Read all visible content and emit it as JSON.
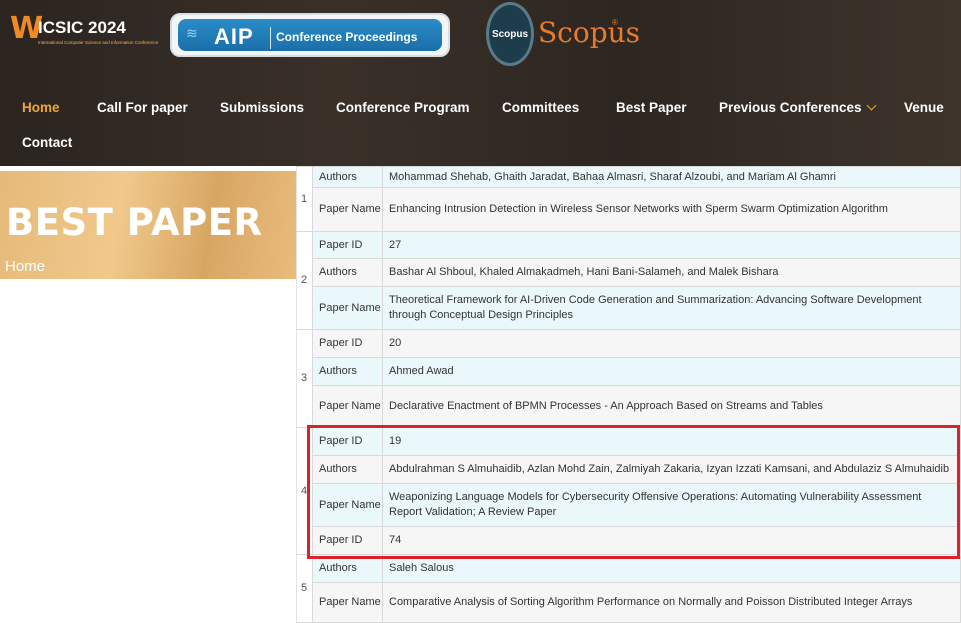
{
  "logos": {
    "icsic_w": "W",
    "icsic_text": "ICSIC 2024",
    "icsic_sub": "International Computer Science and Information Conference",
    "aip": "AIP",
    "aip_sub": "Conference Proceedings",
    "scopus_badge": "Scopus",
    "scopus_word": "Scopus",
    "scopus_reg": "®"
  },
  "nav": {
    "items": [
      "Home",
      "Call For paper",
      "Submissions",
      "Conference Program",
      "Committees",
      "Best Paper",
      "Previous Conferences",
      "Venue",
      "Contact"
    ]
  },
  "banner": {
    "title": "BEST PAPER",
    "breadcrumb": "Home"
  },
  "colors": {
    "accent": "#f0a733",
    "highlight": "#d9232b",
    "row_alt": "#eaf8fb"
  },
  "table": {
    "groups": [
      {
        "num": "1",
        "rows": [
          {
            "label": "Authors",
            "value": "Mohammad Shehab, Ghaith Jaradat, Bahaa Almasri, Sharaf Alzoubi, and Mariam Al Ghamri"
          },
          {
            "label": "Paper Name",
            "value": "Enhancing Intrusion Detection in Wireless Sensor Networks with Sperm Swarm Optimization Algorithm"
          }
        ]
      },
      {
        "num": "2",
        "rows": [
          {
            "label": "Paper ID",
            "value": "27"
          },
          {
            "label": "Authors",
            "value": "Bashar Al Shboul, Khaled Almakadmeh, Hani Bani-Salameh, and Malek Bishara"
          },
          {
            "label": "Paper Name",
            "value": "Theoretical Framework for AI-Driven Code Generation and Summarization: Advancing Software Development through Conceptual Design Principles"
          }
        ]
      },
      {
        "num": "3",
        "rows": [
          {
            "label": "Paper ID",
            "value": "20"
          },
          {
            "label": "Authors",
            "value": "Ahmed Awad"
          },
          {
            "label": "Paper Name",
            "value": "Declarative Enactment of BPMN Processes - An Approach Based on Streams and Tables"
          }
        ]
      },
      {
        "num": "4",
        "rows": [
          {
            "label": "Paper ID",
            "value": "19"
          },
          {
            "label": "Authors",
            "value": "Abdulrahman S Almuhaidib, Azlan Mohd Zain, Zalmiyah Zakaria, Izyan Izzati Kamsani, and Abdulaziz S Almuhaidib"
          },
          {
            "label": "Paper Name",
            "value": "Weaponizing Language Models for Cybersecurity Offensive Operations: Automating Vulnerability Assessment Report Validation; A Review Paper"
          },
          {
            "label": "Paper ID",
            "value": "74"
          }
        ]
      },
      {
        "num": "5",
        "rows": [
          {
            "label": "Authors",
            "value": "Saleh Salous"
          },
          {
            "label": "Paper Name",
            "value": "Comparative Analysis of Sorting Algorithm Performance on Normally and Poisson Distributed Integer Arrays"
          }
        ]
      }
    ]
  }
}
